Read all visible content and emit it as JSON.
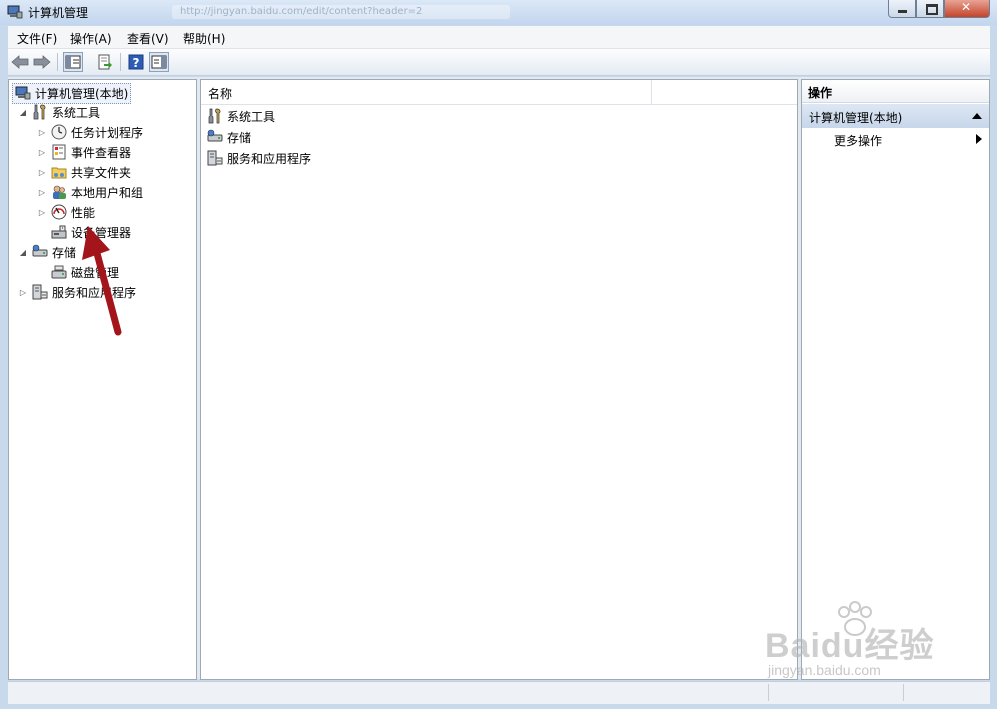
{
  "window": {
    "title": "计算机管理",
    "ghost_address": "http://jingyan.baidu.com/edit/content?header=2"
  },
  "menu": [
    "文件(F)",
    "操作(A)",
    "查看(V)",
    "帮助(H)"
  ],
  "toolbar": {
    "icons": [
      "back-icon",
      "forward-icon",
      "show-hide-tree-icon",
      "export-list-icon",
      "help-icon",
      "show-hide-action-pane-icon"
    ]
  },
  "tree": {
    "root": "计算机管理(本地)",
    "system_tools": {
      "label": "系统工具",
      "children": [
        "任务计划程序",
        "事件查看器",
        "共享文件夹",
        "本地用户和组",
        "性能",
        "设备管理器"
      ]
    },
    "storage": {
      "label": "存储",
      "children": [
        "磁盘管理"
      ]
    },
    "services": "服务和应用程序"
  },
  "list": {
    "column_name": "名称",
    "items": [
      "系统工具",
      "存储",
      "服务和应用程序"
    ]
  },
  "actions": {
    "title": "操作",
    "section": "计算机管理(本地)",
    "more": "更多操作"
  },
  "watermark": {
    "text": "Baidu经验",
    "sub": "jingyan.baidu.com"
  },
  "colors": {
    "accent_arrow": "#a3151a",
    "section_bg": "#c7d6ea"
  }
}
